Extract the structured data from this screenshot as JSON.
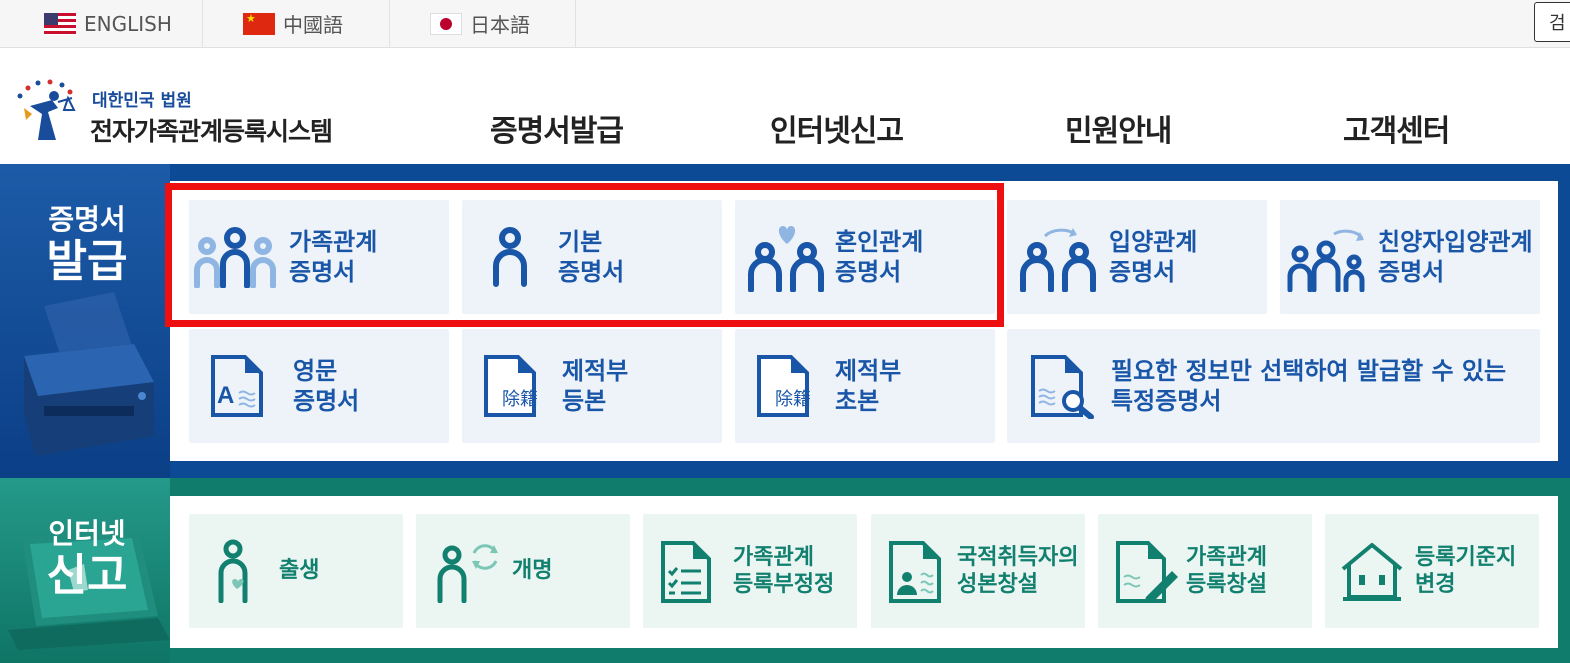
{
  "languages": [
    {
      "label": "ENGLISH",
      "flag": "us-flag-icon"
    },
    {
      "label": "中國語",
      "flag": "china-flag-icon"
    },
    {
      "label": "日本語",
      "flag": "japan-flag-icon"
    }
  ],
  "search_label": "검",
  "logo": {
    "small": "대한민국 법원",
    "big": "전자가족관계등록시스템"
  },
  "nav": [
    "증명서발급",
    "인터넷신고",
    "민원안내",
    "고객센터"
  ],
  "certificates": {
    "title_line1": "증명서",
    "title_line2": "발급",
    "items": [
      {
        "line1": "가족관계",
        "line2": "증명서",
        "icon": "family-icon"
      },
      {
        "line1": "기본",
        "line2": "증명서",
        "icon": "person-icon"
      },
      {
        "line1": "혼인관계",
        "line2": "증명서",
        "icon": "marriage-icon"
      },
      {
        "line1": "입양관계",
        "line2": "증명서",
        "icon": "adoption-icon"
      },
      {
        "line1": "친양자입양관계",
        "line2": "증명서",
        "icon": "full-adoption-icon"
      },
      {
        "line1": "영문",
        "line2": "증명서",
        "icon": "english-document-icon"
      },
      {
        "line1": "제적부",
        "line2": "등본",
        "icon": "removed-register-icon",
        "badge": "除籍"
      },
      {
        "line1": "제적부",
        "line2": "초본",
        "icon": "removed-register-icon",
        "badge": "除籍"
      },
      {
        "line1": "필요한 정보만 선택하여 발급할 수 있는",
        "line2": "특정증명서",
        "icon": "document-search-icon"
      }
    ]
  },
  "reports": {
    "title_line1": "인터넷",
    "title_line2": "신고",
    "items": [
      {
        "line1": "출생",
        "line2": "",
        "icon": "birth-icon"
      },
      {
        "line1": "개명",
        "line2": "",
        "icon": "rename-icon"
      },
      {
        "line1": "가족관계",
        "line2": "등록부정정",
        "icon": "checklist-icon"
      },
      {
        "line1": "국적취득자의",
        "line2": "성본창설",
        "icon": "id-document-icon"
      },
      {
        "line1": "가족관계",
        "line2": "등록창설",
        "icon": "document-pen-icon"
      },
      {
        "line1": "등록기준지",
        "line2": "변경",
        "icon": "house-icon"
      }
    ]
  },
  "colors": {
    "cert_band": "#0d4a96",
    "cert_text": "#1a56a8",
    "net_band": "#0f7c6c",
    "net_text": "#12806f",
    "highlight": "#ee1010"
  }
}
